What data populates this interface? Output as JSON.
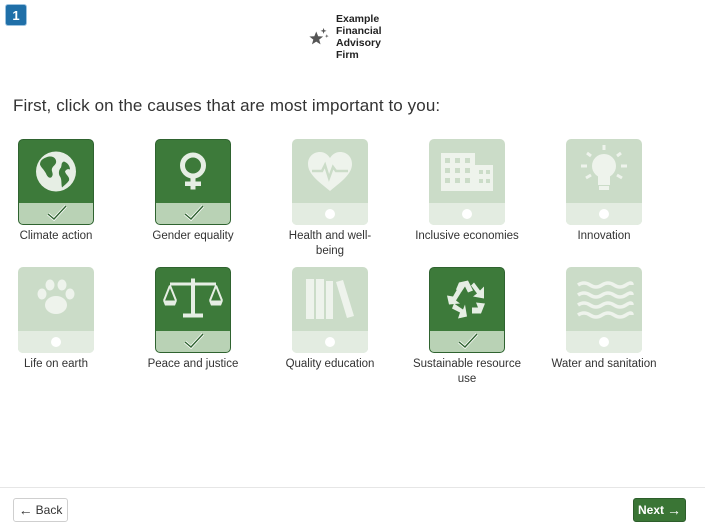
{
  "header": {
    "step_number": "1",
    "brand_name_lines": [
      "Example",
      "Financial",
      "Advisory",
      "Firm"
    ]
  },
  "prompt": "First, click on the causes that are most important to you:",
  "causes": [
    {
      "label": "Climate action",
      "icon": "globe-icon",
      "selected": true
    },
    {
      "label": "Gender equality",
      "icon": "female-symbol-icon",
      "selected": true
    },
    {
      "label": "Health and well-being",
      "icon": "heart-pulse-icon",
      "selected": false
    },
    {
      "label": "Inclusive economies",
      "icon": "buildings-icon",
      "selected": false
    },
    {
      "label": "Innovation",
      "icon": "lightbulb-icon",
      "selected": false
    },
    {
      "label": "Life on earth",
      "icon": "paw-icon",
      "selected": false
    },
    {
      "label": "Peace and justice",
      "icon": "scales-icon",
      "selected": true
    },
    {
      "label": "Quality education",
      "icon": "books-icon",
      "selected": false
    },
    {
      "label": "Sustainable resource use",
      "icon": "recycle-icon",
      "selected": true
    },
    {
      "label": "Water and sanitation",
      "icon": "waves-icon",
      "selected": false
    }
  ],
  "footer": {
    "back_label": "Back",
    "next_label": "Next"
  },
  "colors": {
    "selected_tile": "#3d7a3a",
    "unselected_tile": "#cbdcc8",
    "next_button": "#3a7535",
    "step_badge": "#1f6fa8"
  }
}
